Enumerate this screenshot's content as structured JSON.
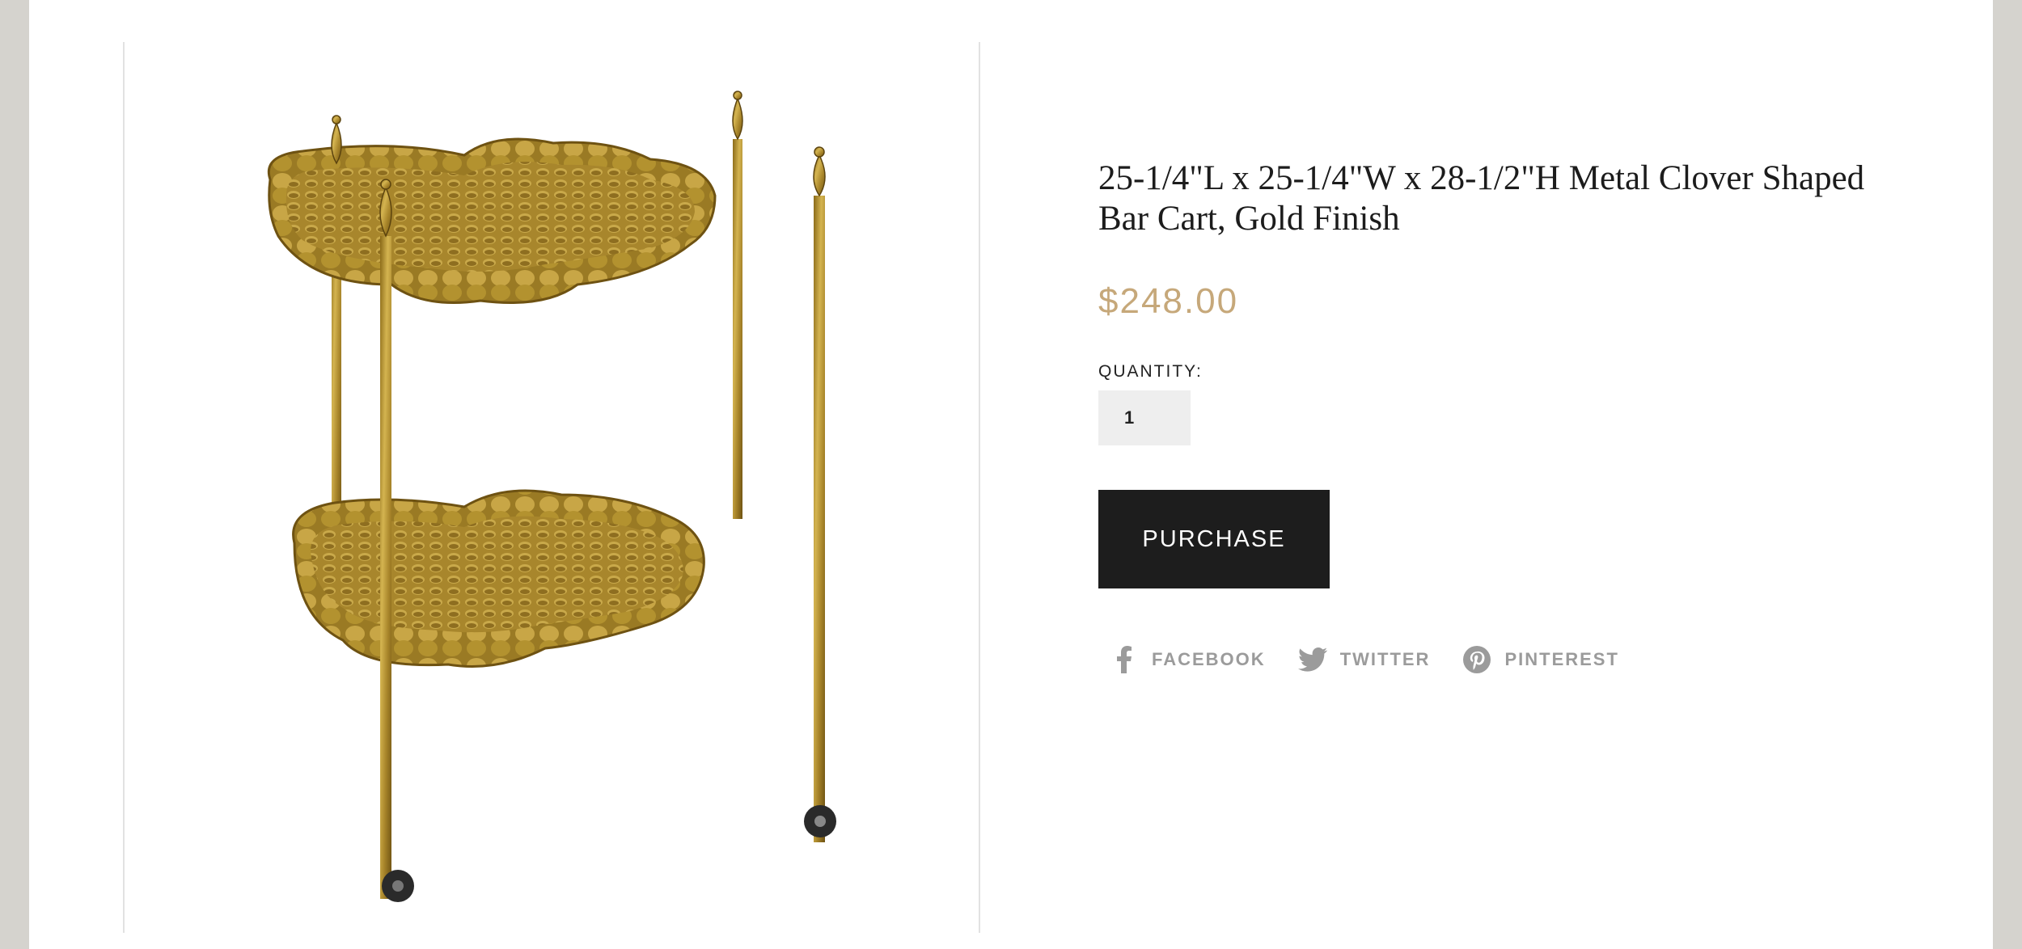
{
  "product": {
    "title": "25-1/4\"L x 25-1/4\"W x 28-1/2\"H Metal Clover Shaped Bar Cart, Gold Finish",
    "price": "$248.00",
    "quantity_label": "QUANTITY:",
    "quantity_value": "1",
    "purchase_label": "PURCHASE"
  },
  "share": {
    "facebook": {
      "label": "FACEBOOK",
      "icon": "facebook-icon"
    },
    "twitter": {
      "label": "TWITTER",
      "icon": "twitter-icon"
    },
    "pinterest": {
      "label": "PINTEREST",
      "icon": "pinterest-icon"
    }
  },
  "colors": {
    "background": "#d5d3ce",
    "page": "#ffffff",
    "price": "#c6a87a",
    "button": "#1d1d1d",
    "social": "#9b9b9b",
    "gold": "#b8942e"
  }
}
